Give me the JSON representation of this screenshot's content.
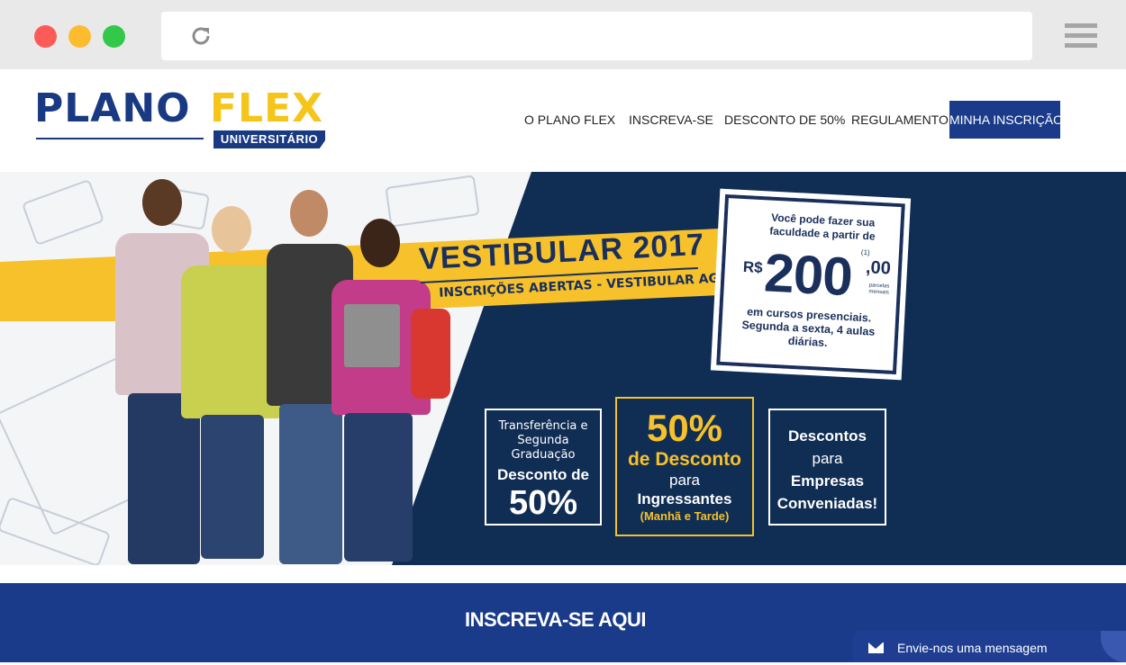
{
  "browser": {
    "reload_icon": "reload-icon",
    "menu_icon": "hamburger-menu-icon",
    "window_controls": [
      "close",
      "minimize",
      "maximize"
    ]
  },
  "logo": {
    "word1": "PLANO",
    "word2": "FLEX",
    "sub": "UNIVERSITÁRIO"
  },
  "nav": {
    "items": [
      "O PLANO FLEX",
      "INSCREVA-SE",
      "DESCONTO DE 50%",
      "REGULAMENTO"
    ],
    "cta": "MINHA INSCRIÇÃO"
  },
  "hero": {
    "title": "VESTIBULAR 2017",
    "subtitle": "INSCRIÇÕES ABERTAS - VESTIBULAR AGENDADO",
    "price_card": {
      "intro": "Você pode fazer sua faculdade a partir de",
      "currency": "R$",
      "amount": "200",
      "cents": ",00",
      "footnote": "(1)",
      "note": "parcelas mensais",
      "body": "em cursos presenciais. Segunda a sexta, 4 aulas diárias."
    },
    "promos": [
      {
        "line1": "Transferência e Segunda Graduação",
        "line2": "Desconto de",
        "line3": "50%"
      },
      {
        "line1": "50%",
        "line2": "de Desconto",
        "line3": "para",
        "line4": "Ingressantes",
        "line5": "(Manhã e Tarde)"
      },
      {
        "line1": "Descontos",
        "line2": "para",
        "line3": "Empresas",
        "line4": "Conveniadas!"
      }
    ]
  },
  "band": {
    "title": "INSCREVA-SE AQUI"
  },
  "chat": {
    "label": "Envie-nos uma mensagem",
    "icon": "envelope-icon"
  },
  "colors": {
    "brand_blue": "#1a3b8a",
    "brand_yellow": "#f6c12a",
    "hero_navy": "#102d54"
  }
}
